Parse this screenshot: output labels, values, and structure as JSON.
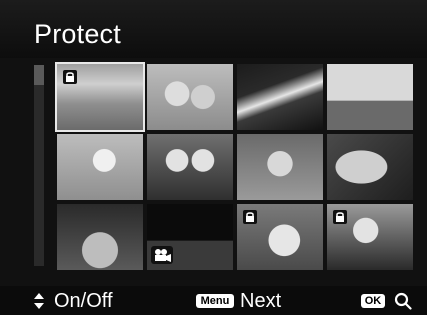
{
  "screen": {
    "title": "Protect"
  },
  "thumbnails": [
    {
      "name": "landscape-photo",
      "protected": true,
      "selected": true,
      "video": false
    },
    {
      "name": "couple-photo",
      "protected": false,
      "selected": false,
      "video": false
    },
    {
      "name": "road-night-photo",
      "protected": false,
      "selected": false,
      "video": false
    },
    {
      "name": "big-ben-photo",
      "protected": false,
      "selected": false,
      "video": false
    },
    {
      "name": "woman-sky-photo",
      "protected": false,
      "selected": false,
      "video": false
    },
    {
      "name": "twins-photo",
      "protected": false,
      "selected": false,
      "video": false
    },
    {
      "name": "baby-photo",
      "protected": false,
      "selected": false,
      "video": false
    },
    {
      "name": "leaf-macro-photo",
      "protected": false,
      "selected": false,
      "video": false
    },
    {
      "name": "ferris-wheel-photo",
      "protected": false,
      "selected": false,
      "video": false
    },
    {
      "name": "city-night-video",
      "protected": false,
      "selected": false,
      "video": true
    },
    {
      "name": "teddy-bear-photo",
      "protected": true,
      "selected": false,
      "video": false
    },
    {
      "name": "girl-portrait-photo",
      "protected": true,
      "selected": false,
      "video": false
    }
  ],
  "footer": {
    "onoff_label": "On/Off",
    "menu_key": "Menu",
    "next_label": "Next",
    "ok_key": "OK"
  },
  "icons": {
    "lock": "lock-icon",
    "movie": "movie-camera-icon",
    "updown": "up-down-arrows-icon",
    "search": "magnifier-icon"
  }
}
